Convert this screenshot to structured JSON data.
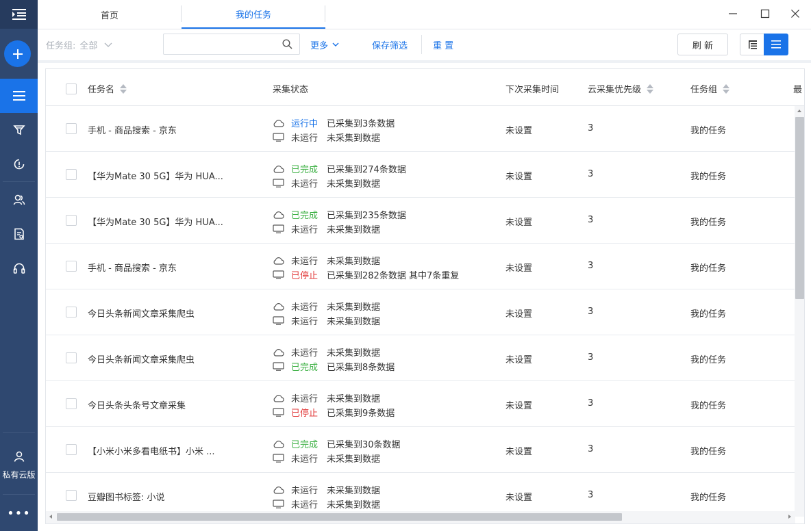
{
  "tabs": {
    "home": "首页",
    "my_tasks": "我的任务"
  },
  "sidebar": {
    "private_cloud": "私有云版",
    "more": "•••"
  },
  "filter": {
    "group_label": "任务组:",
    "group_value": "全部",
    "search_placeholder": "",
    "more": "更多",
    "save_filter": "保存筛选",
    "reset": "重 置",
    "refresh": "刷 新"
  },
  "table": {
    "headers": {
      "name": "任务名",
      "status": "采集状态",
      "next_time": "下次采集时间",
      "priority": "云采集优先级",
      "group": "任务组",
      "last": "最"
    },
    "rows": [
      {
        "name": "手机 - 商品搜索 - 京东",
        "cloud_status": "运行中",
        "cloud_kind": "running",
        "cloud_text": "已采集到3条数据",
        "local_status": "未运行",
        "local_kind": "idle",
        "local_text": "未采集到数据",
        "next_time": "未设置",
        "priority": "3",
        "group": "我的任务"
      },
      {
        "name": "【华为Mate 30 5G】华为 HUA...",
        "cloud_status": "已完成",
        "cloud_kind": "done",
        "cloud_text": "已采集到274条数据",
        "local_status": "未运行",
        "local_kind": "idle",
        "local_text": "未采集到数据",
        "next_time": "未设置",
        "priority": "3",
        "group": "我的任务"
      },
      {
        "name": "【华为Mate 30 5G】华为 HUA...",
        "cloud_status": "已完成",
        "cloud_kind": "done",
        "cloud_text": "已采集到235条数据",
        "local_status": "未运行",
        "local_kind": "idle",
        "local_text": "未采集到数据",
        "next_time": "未设置",
        "priority": "3",
        "group": "我的任务"
      },
      {
        "name": "手机 - 商品搜索 - 京东",
        "cloud_status": "未运行",
        "cloud_kind": "idle",
        "cloud_text": "未采集到数据",
        "local_status": "已停止",
        "local_kind": "stopped",
        "local_text": "已采集到282条数据 其中7条重复",
        "next_time": "未设置",
        "priority": "3",
        "group": "我的任务"
      },
      {
        "name": "今日头条新闻文章采集爬虫",
        "cloud_status": "未运行",
        "cloud_kind": "idle",
        "cloud_text": "未采集到数据",
        "local_status": "未运行",
        "local_kind": "idle",
        "local_text": "未采集到数据",
        "next_time": "未设置",
        "priority": "3",
        "group": "我的任务"
      },
      {
        "name": "今日头条新闻文章采集爬虫",
        "cloud_status": "未运行",
        "cloud_kind": "idle",
        "cloud_text": "未采集到数据",
        "local_status": "已完成",
        "local_kind": "done",
        "local_text": "已采集到8条数据",
        "next_time": "未设置",
        "priority": "3",
        "group": "我的任务"
      },
      {
        "name": "今日头条头条号文章采集",
        "cloud_status": "未运行",
        "cloud_kind": "idle",
        "cloud_text": "未采集到数据",
        "local_status": "已停止",
        "local_kind": "stopped",
        "local_text": "已采集到9条数据",
        "next_time": "未设置",
        "priority": "3",
        "group": "我的任务"
      },
      {
        "name": "【小米小米多看电纸书】小米 ...",
        "cloud_status": "已完成",
        "cloud_kind": "done",
        "cloud_text": "已采集到30条数据",
        "local_status": "未运行",
        "local_kind": "idle",
        "local_text": "未采集到数据",
        "next_time": "未设置",
        "priority": "3",
        "group": "我的任务"
      },
      {
        "name": "豆瓣图书标签: 小说",
        "cloud_status": "未运行",
        "cloud_kind": "idle",
        "cloud_text": "未采集到数据",
        "local_status": "未运行",
        "local_kind": "idle",
        "local_text": "未采集到数据",
        "next_time": "未设置",
        "priority": "3",
        "group": "我的任务"
      }
    ]
  },
  "colors": {
    "accent": "#1a73e8",
    "sidebar": "#2f4870",
    "done": "#3cb043",
    "stopped": "#e23b3b"
  }
}
